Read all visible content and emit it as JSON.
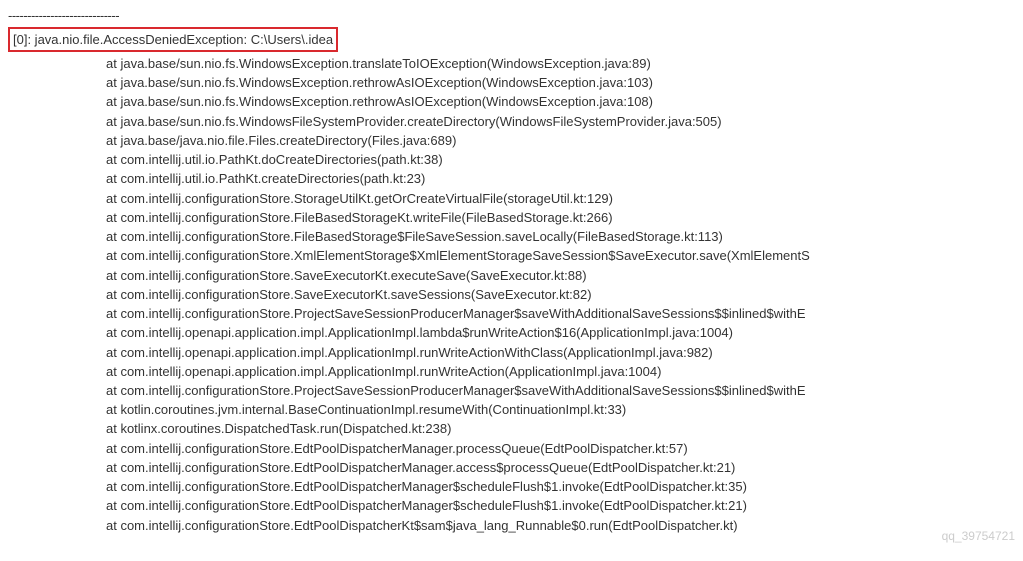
{
  "separator": "-----------------------------",
  "exception": "[0]: java.nio.file.AccessDeniedException: C:\\Users\\.idea",
  "stack": [
    "at java.base/sun.nio.fs.WindowsException.translateToIOException(WindowsException.java:89)",
    "at java.base/sun.nio.fs.WindowsException.rethrowAsIOException(WindowsException.java:103)",
    "at java.base/sun.nio.fs.WindowsException.rethrowAsIOException(WindowsException.java:108)",
    "at java.base/sun.nio.fs.WindowsFileSystemProvider.createDirectory(WindowsFileSystemProvider.java:505)",
    "at java.base/java.nio.file.Files.createDirectory(Files.java:689)",
    "at com.intellij.util.io.PathKt.doCreateDirectories(path.kt:38)",
    "at com.intellij.util.io.PathKt.createDirectories(path.kt:23)",
    "at com.intellij.configurationStore.StorageUtilKt.getOrCreateVirtualFile(storageUtil.kt:129)",
    "at com.intellij.configurationStore.FileBasedStorageKt.writeFile(FileBasedStorage.kt:266)",
    "at com.intellij.configurationStore.FileBasedStorage$FileSaveSession.saveLocally(FileBasedStorage.kt:113)",
    "at com.intellij.configurationStore.XmlElementStorage$XmlElementStorageSaveSession$SaveExecutor.save(XmlElementS",
    "at com.intellij.configurationStore.SaveExecutorKt.executeSave(SaveExecutor.kt:88)",
    "at com.intellij.configurationStore.SaveExecutorKt.saveSessions(SaveExecutor.kt:82)",
    "at com.intellij.configurationStore.ProjectSaveSessionProducerManager$saveWithAdditionalSaveSessions$$inlined$withE",
    "at com.intellij.openapi.application.impl.ApplicationImpl.lambda$runWriteAction$16(ApplicationImpl.java:1004)",
    "at com.intellij.openapi.application.impl.ApplicationImpl.runWriteActionWithClass(ApplicationImpl.java:982)",
    "at com.intellij.openapi.application.impl.ApplicationImpl.runWriteAction(ApplicationImpl.java:1004)",
    "at com.intellij.configurationStore.ProjectSaveSessionProducerManager$saveWithAdditionalSaveSessions$$inlined$withE",
    "at kotlin.coroutines.jvm.internal.BaseContinuationImpl.resumeWith(ContinuationImpl.kt:33)",
    "at kotlinx.coroutines.DispatchedTask.run(Dispatched.kt:238)",
    "at com.intellij.configurationStore.EdtPoolDispatcherManager.processQueue(EdtPoolDispatcher.kt:57)",
    "at com.intellij.configurationStore.EdtPoolDispatcherManager.access$processQueue(EdtPoolDispatcher.kt:21)",
    "at com.intellij.configurationStore.EdtPoolDispatcherManager$scheduleFlush$1.invoke(EdtPoolDispatcher.kt:35)",
    "at com.intellij.configurationStore.EdtPoolDispatcherManager$scheduleFlush$1.invoke(EdtPoolDispatcher.kt:21)",
    "at com.intellij.configurationStore.EdtPoolDispatcherKt$sam$java_lang_Runnable$0.run(EdtPoolDispatcher.kt)"
  ],
  "watermark": "qq_39754721"
}
